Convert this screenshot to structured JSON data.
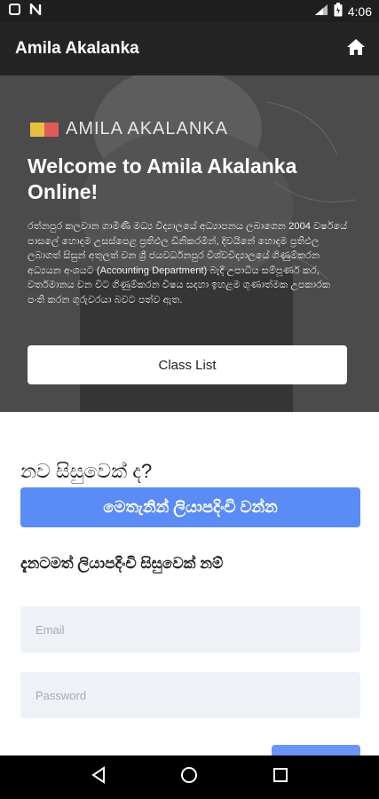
{
  "status_bar": {
    "time": "4:06",
    "icons": [
      "square-icon",
      "n-icon",
      "signal-icon",
      "battery-icon"
    ]
  },
  "app_bar": {
    "title": "Amila Akalanka",
    "home_icon": "home-icon"
  },
  "hero": {
    "brand_text": "AMILA AKALANKA",
    "brand_colors": [
      "#e8c040",
      "#e05a5a"
    ],
    "title": "Welcome to Amila Akalanka Online!",
    "description": "රත්නපුර කලවාන ගාමිණි මධ්‍ය විද්‍යාලයේ අධ්‍යාපනය ලබාගෙන 2004 වර්ෂයේ පාසලේ හොදම උසස්පෙළ ප්‍රතිඵල ඩීනිකරමින්, දිවයිනේ හොදම ප්‍රතිඵල ලබාගත් සිසුන් අතුලත් වන ශ්‍රී ජයවර්ධනපුර විශ්වවිද්‍යාලයේ ගිණුම්කරන අධ්‍යයන අංශයට (Accounting Department) බැදී උපාධිය සම්පූර්ණ කර, වර්තමානය වන විට ගිණුම්කරන විෂය සදහා ඉහළම ගුණාත්මක උපකාරක පංති කරන ගුරුවරයා බවට පත්ව ඇත.",
    "class_list_label": "Class List"
  },
  "form": {
    "new_student_label": "නව සිසුවෙක් ද?",
    "register_label": "මෙතැනින් ලියාපදිංචි වන්න",
    "registered_label": "දැනටමත් ලියාපදිංචි සිසුවෙක් නම්",
    "email_placeholder": "Email",
    "password_placeholder": "Password",
    "accent_color": "#5b8cf5"
  },
  "nav_bar": {
    "icons": [
      "back-icon",
      "home-circle-icon",
      "recents-icon"
    ]
  }
}
